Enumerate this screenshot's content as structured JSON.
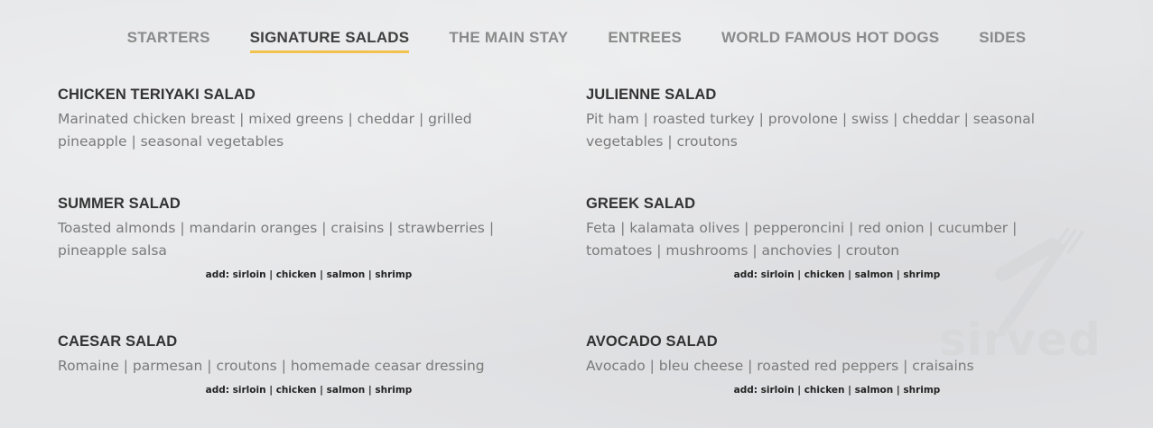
{
  "tabs": [
    {
      "label": "STARTERS",
      "active": false
    },
    {
      "label": "SIGNATURE SALADS",
      "active": true
    },
    {
      "label": "THE MAIN STAY",
      "active": false
    },
    {
      "label": "ENTREES",
      "active": false
    },
    {
      "label": "WORLD FAMOUS HOT DOGS",
      "active": false
    },
    {
      "label": "SIDES",
      "active": false
    }
  ],
  "accent_color": "#f2c14e",
  "items": [
    {
      "name": "CHICKEN TERIYAKI SALAD",
      "desc": "Marinated chicken breast | mixed greens | cheddar | grilled pineapple | seasonal vegetables",
      "addons": ""
    },
    {
      "name": "JULIENNE SALAD",
      "desc": "Pit ham | roasted turkey | provolone | swiss | cheddar | seasonal vegetables | croutons",
      "addons": ""
    },
    {
      "name": "SUMMER SALAD",
      "desc": "Toasted almonds | mandarin oranges | craisins | strawberries | pineapple salsa",
      "addons": "add: sirloin | chicken | salmon | shrimp"
    },
    {
      "name": "GREEK SALAD",
      "desc": "Feta | kalamata olives | pepperoncini | red onion | cucumber | tomatoes | mushrooms | anchovies | crouton",
      "addons": "add: sirloin | chicken | salmon | shrimp"
    },
    {
      "name": "CAESAR SALAD",
      "desc": "Romaine | parmesan | croutons | homemade ceasar dressing",
      "addons": "add: sirloin | chicken | salmon | shrimp"
    },
    {
      "name": "AVOCADO SALAD",
      "desc": "Avocado | bleu cheese | roasted red peppers | craisains",
      "addons": "add: sirloin | chicken | salmon | shrimp"
    }
  ],
  "watermark": {
    "text": "sirved",
    "icon": "knife-fork-icon"
  }
}
